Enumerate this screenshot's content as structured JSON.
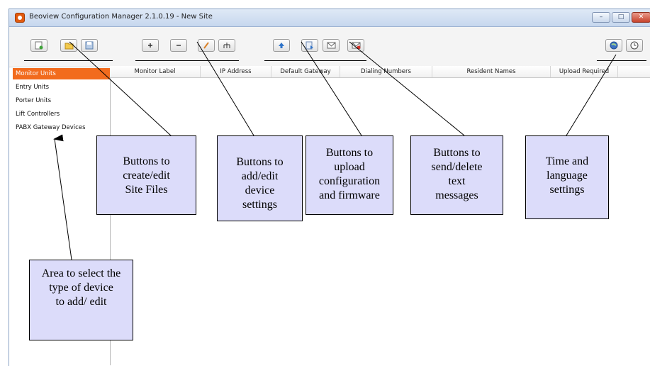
{
  "window": {
    "title": "Beoview Configuration Manager 2.1.0.19 - New Site",
    "controls": [
      "–",
      "□",
      "✕"
    ]
  },
  "toolbar": {
    "site_file_buttons": [
      "new-site-icon",
      "open-site-icon",
      "save-site-icon"
    ],
    "device_buttons": [
      "add-icon",
      "remove-icon",
      "edit-icon",
      "network-icon"
    ],
    "upload_buttons": [
      "upload-config-icon",
      "upload-firmware-icon"
    ],
    "message_buttons": [
      "send-message-icon",
      "delete-message-icon"
    ],
    "settings_buttons": [
      "language-globe-icon",
      "time-clock-icon"
    ]
  },
  "sidebar": {
    "items": [
      {
        "label": "Monitor Units",
        "selected": true
      },
      {
        "label": "Entry Units",
        "selected": false
      },
      {
        "label": "Porter Units",
        "selected": false
      },
      {
        "label": "Lift Controllers",
        "selected": false
      },
      {
        "label": "PABX Gateway Devices",
        "selected": false
      }
    ]
  },
  "table": {
    "columns": [
      "Monitor Label",
      "IP Address",
      "Default Gateway",
      "Dialing Numbers",
      "Resident Names",
      "Upload Required"
    ]
  },
  "callouts": {
    "site_files": [
      "Buttons to",
      "create/edit",
      "Site Files"
    ],
    "device_settings": [
      "Buttons to",
      "add/edit",
      "device",
      "settings"
    ],
    "upload": [
      "Buttons to",
      "upload",
      "configuration",
      "and firmware"
    ],
    "messages": [
      "Buttons to",
      "send/delete",
      "text",
      "messages"
    ],
    "time_language": [
      "Time and",
      "language",
      "settings"
    ],
    "device_area": [
      "Area to select the",
      "type of device",
      "to add/ edit"
    ]
  },
  "colors": {
    "selected_item": "#f26b1d",
    "callout_fill": "#dcdcfa",
    "titlebar": "#c6d7ee"
  }
}
